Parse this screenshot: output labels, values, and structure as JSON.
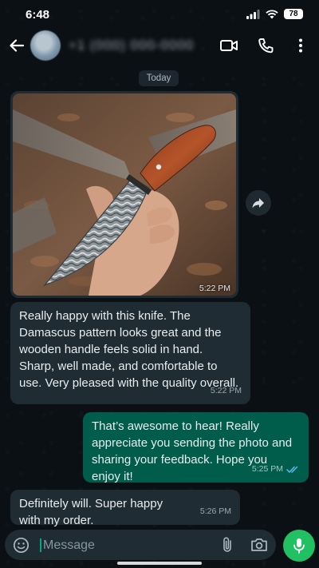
{
  "status_bar": {
    "time": "6:48",
    "battery": "78"
  },
  "header": {
    "contact_name": "+1 (000) 000-0000"
  },
  "date_chip": "Today",
  "messages": [
    {
      "type": "image",
      "direction": "incoming",
      "time": "5:22 PM"
    },
    {
      "type": "text",
      "direction": "incoming",
      "lines": [
        "Really happy with this knife. The Damascus pattern looks great and the wooden handle feels solid in hand.",
        "Sharp, well made, and comfortable to use. Very pleased with the quality overall."
      ],
      "time": "5:22 PM"
    },
    {
      "type": "text",
      "direction": "outgoing",
      "lines": [
        "That’s awesome to hear! Really appreciate you sending the photo and sharing your feedback. Hope you enjoy it!"
      ],
      "time": "5:25 PM",
      "status": "read"
    },
    {
      "type": "text",
      "direction": "incoming",
      "lines": [
        "Definitely will. Super happy with my order."
      ],
      "time": "5:26 PM"
    }
  ],
  "input": {
    "placeholder": "Message",
    "value": ""
  },
  "colors": {
    "incoming_bubble": "#1f2c33",
    "outgoing_bubble": "#005c4b",
    "accent": "#21c063",
    "read_ticks": "#53bdeb"
  },
  "icons": [
    "back-arrow-icon",
    "video-call-icon",
    "voice-call-icon",
    "more-options-icon",
    "forward-icon",
    "emoji-icon",
    "attach-icon",
    "camera-icon",
    "mic-icon",
    "read-ticks-icon"
  ]
}
